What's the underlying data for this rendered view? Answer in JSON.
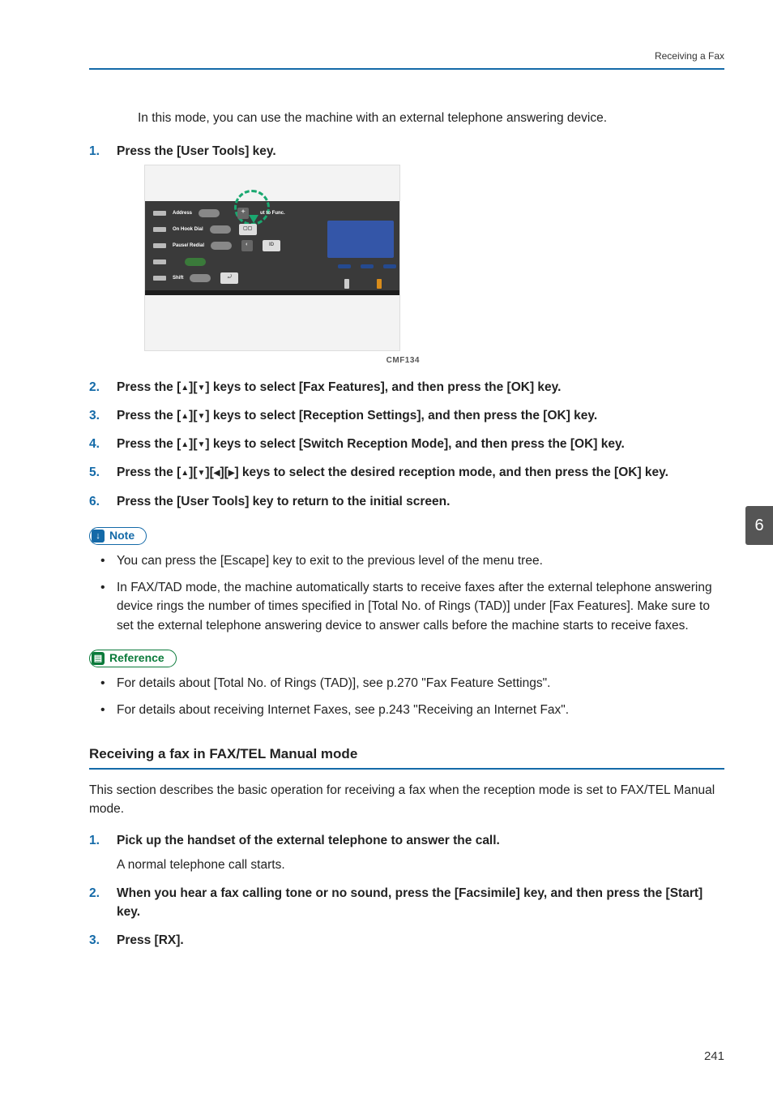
{
  "header": {
    "running": "Receiving a Fax"
  },
  "intro": "In this mode, you can use the machine with an external telephone answering device.",
  "steps_a": {
    "s1": "Press the [User Tools] key.",
    "s2a": "Press the [",
    "s2b": "][",
    "s2c": "] keys to select [Fax Features], and then press the [OK] key.",
    "s3a": "Press the [",
    "s3b": "][",
    "s3c": "] keys to select [Reception Settings], and then press the [OK] key.",
    "s4a": "Press the [",
    "s4b": "][",
    "s4c": "] keys to select [Switch Reception Mode], and then press the [OK] key.",
    "s5a": "Press the [",
    "s5b": "][",
    "s5c": "][",
    "s5d": "][",
    "s5e": "] keys to select the desired reception mode, and then press the [OK] key.",
    "s6": "Press the [User Tools] key to return to the initial screen."
  },
  "figure": {
    "labels": {
      "l1": "Address",
      "l2": "On Hook Dial",
      "l3": "Pause/ Redial",
      "l4": "Shift",
      "right": "ut to Func."
    },
    "caption": "CMF134"
  },
  "note": {
    "label": "Note",
    "items": {
      "n1": "You can press the [Escape] key to exit to the previous level of the menu tree.",
      "n2": "In FAX/TAD mode, the machine automatically starts to receive faxes after the external telephone answering device rings the number of times specified in [Total No. of Rings (TAD)] under [Fax Features]. Make sure to set the external telephone answering device to answer calls before the machine starts to receive faxes."
    }
  },
  "reference": {
    "label": "Reference",
    "items": {
      "r1": "For details about [Total No. of Rings (TAD)], see p.270 \"Fax Feature Settings\".",
      "r2": "For details about receiving Internet Faxes, see p.243 \"Receiving an Internet Fax\"."
    }
  },
  "subsection": {
    "title": "Receiving a fax in FAX/TEL Manual mode",
    "intro": "This section describes the basic operation for receiving a fax when the reception mode is set to FAX/TEL Manual mode."
  },
  "steps_b": {
    "s1": "Pick up the handset of the external telephone to answer the call.",
    "s1_sub": "A normal telephone call starts.",
    "s2": "When you hear a fax calling tone or no sound, press the [Facsimile] key, and then press the [Start] key.",
    "s3": "Press [RX]."
  },
  "chapter": "6",
  "page_number": "241"
}
